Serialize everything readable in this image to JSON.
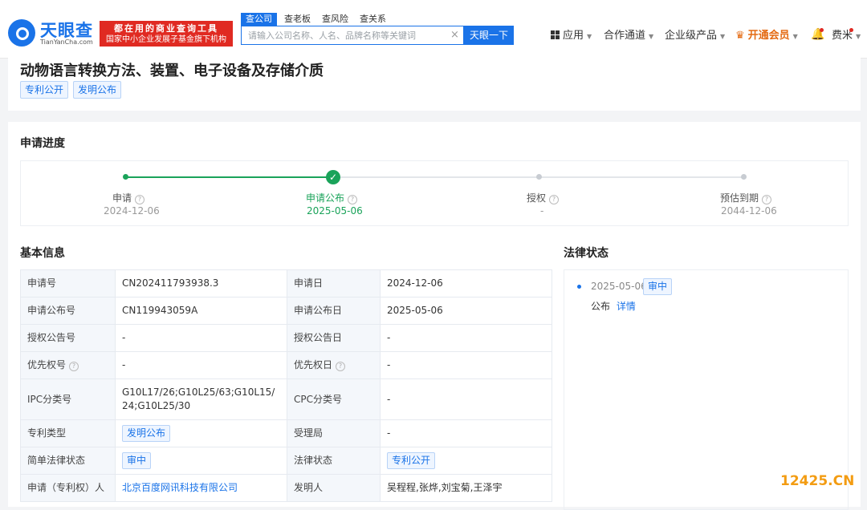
{
  "header": {
    "logo_name": "天眼查",
    "logo_domain": "TianYanCha.com",
    "slogan_line1": "都在用的商业查询工具",
    "slogan_line2": "国家中小企业发展子基金旗下机构",
    "search_tabs": [
      "查公司",
      "查老板",
      "查风险",
      "查关系"
    ],
    "search_placeholder": "请输入公司名称、人名、品牌名称等关键词",
    "search_button": "天眼一下",
    "nav_apps": "应用",
    "nav_partner": "合作通道",
    "nav_enterprise": "企业级产品",
    "nav_vip": "开通会员",
    "nav_user": "费米"
  },
  "title_card": {
    "title": "动物语言转换方法、装置、电子设备及存储介质",
    "tags": [
      "专利公开",
      "发明公布"
    ]
  },
  "progress": {
    "section_title": "申请进度",
    "steps": [
      {
        "label": "申请",
        "date": "2024-12-06"
      },
      {
        "label": "申请公布",
        "date": "2025-05-06"
      },
      {
        "label": "授权",
        "date": "-"
      },
      {
        "label": "预估到期",
        "date": "2044-12-06"
      }
    ]
  },
  "basic_info": {
    "section_title": "基本信息",
    "rows": [
      {
        "k1": "申请号",
        "v1": "CN202411793938.3",
        "k2": "申请日",
        "v2": "2024-12-06"
      },
      {
        "k1": "申请公布号",
        "v1": "CN119943059A",
        "k2": "申请公布日",
        "v2": "2025-05-06"
      },
      {
        "k1": "授权公告号",
        "v1": "-",
        "k2": "授权公告日",
        "v2": "-"
      },
      {
        "k1": "优先权号",
        "v1": "-",
        "k2": "优先权日",
        "v2": "-"
      },
      {
        "k1": "IPC分类号",
        "v1": "G10L17/26;G10L25/63;G10L15/24;G10L25/30",
        "k2": "CPC分类号",
        "v2": "-"
      },
      {
        "k1": "专利类型",
        "v1": "发明公布",
        "k2": "受理局",
        "v2": "-"
      },
      {
        "k1": "简单法律状态",
        "v1": "审中",
        "k2": "法律状态",
        "v2": "专利公开"
      },
      {
        "k1": "申请（专利权）人",
        "v1": "北京百度网讯科技有限公司",
        "k2": "发明人",
        "v2": "吴程程,张烨,刘宝菊,王泽宇"
      }
    ]
  },
  "legal_status": {
    "section_title": "法律状态",
    "date": "2025-05-06",
    "tag": "审中",
    "text": "公布",
    "detail_link": "详情"
  },
  "watermark": "12425.CN",
  "colors": {
    "brand": "#1a73e8",
    "success": "#1aa35a",
    "vip": "#e46a12",
    "slogan_bg": "#e02a22"
  }
}
